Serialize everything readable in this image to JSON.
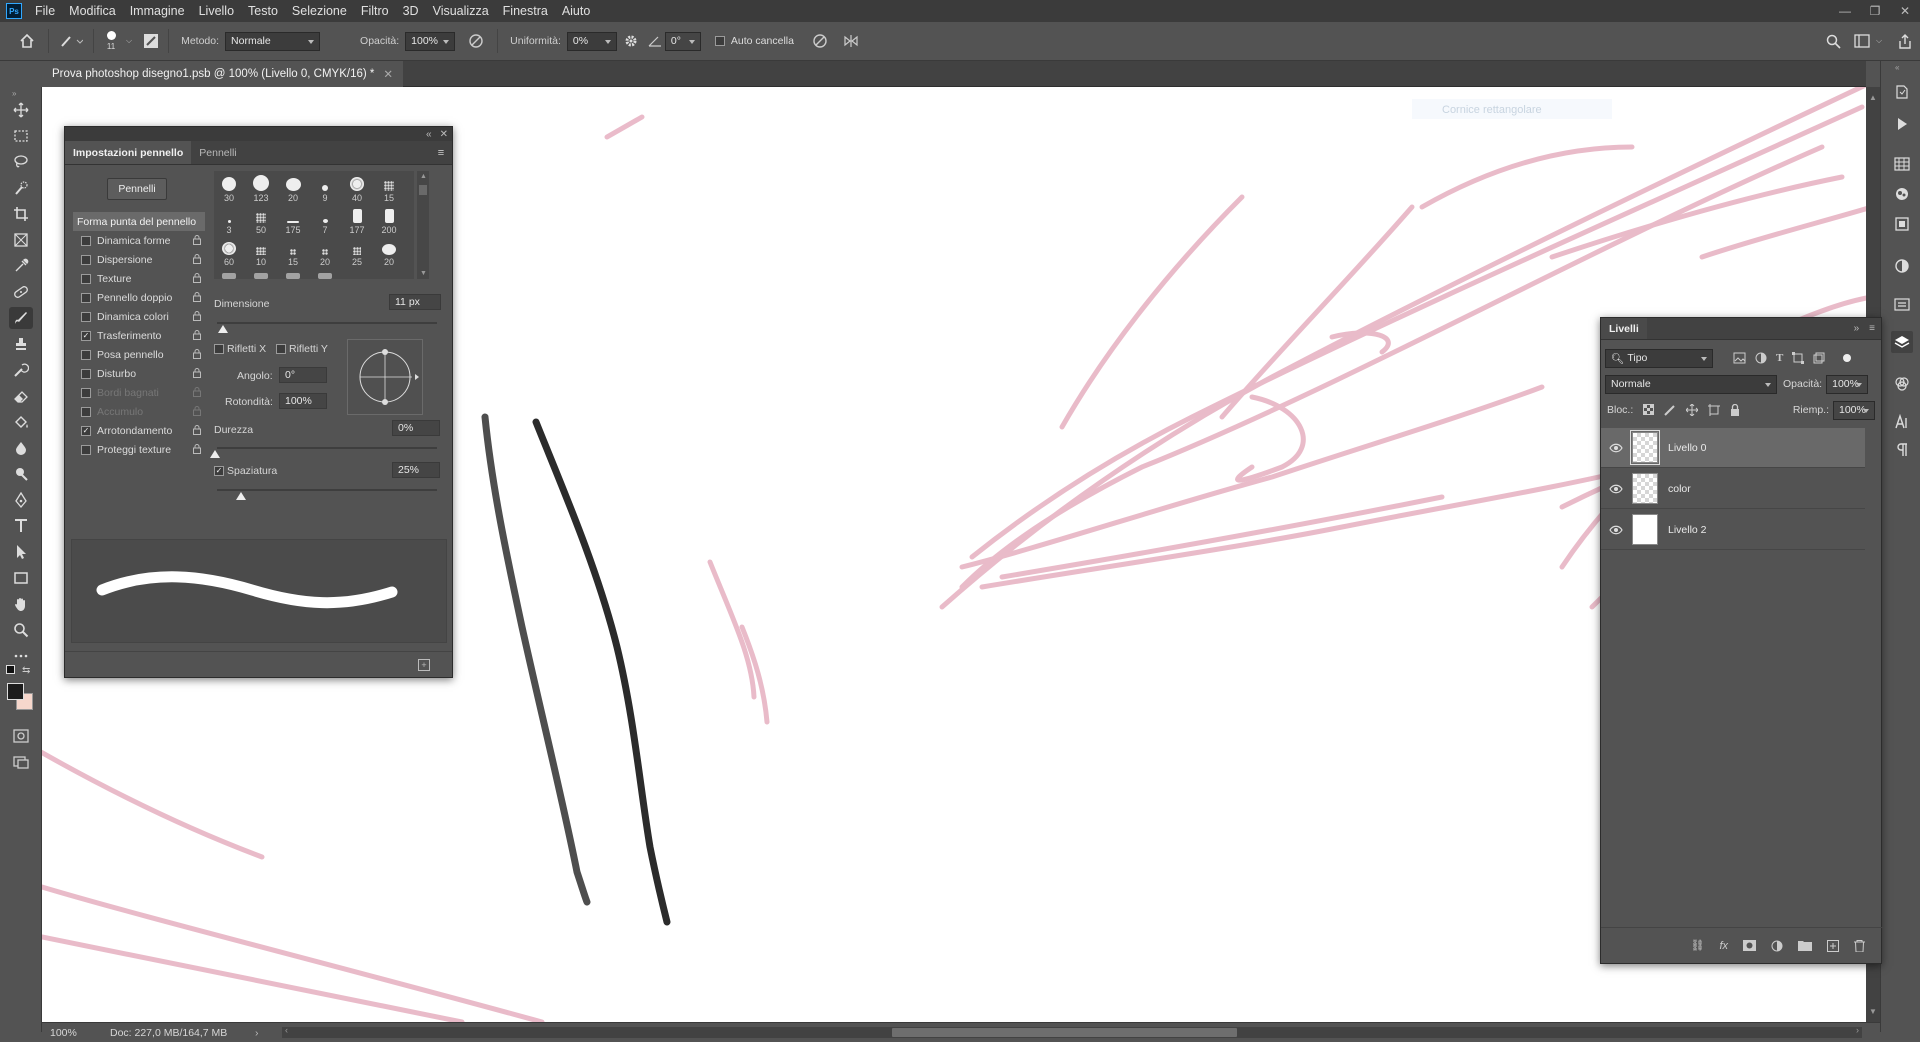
{
  "app": {
    "logo": "Ps"
  },
  "menu": [
    "File",
    "Modifica",
    "Immagine",
    "Livello",
    "Testo",
    "Selezione",
    "Filtro",
    "3D",
    "Visualizza",
    "Finestra",
    "Aiuto"
  ],
  "options": {
    "brush_size": "11",
    "metodo_label": "Metodo:",
    "metodo_value": "Normale",
    "opacita_label": "Opacità:",
    "opacita_value": "100%",
    "uniformita_label": "Uniformità:",
    "uniformita_value": "0%",
    "angle_value": "0°",
    "auto_cancella": "Auto cancella"
  },
  "document": {
    "tab_title": "Prova photoshop disegno1.psb @ 100% (Livello 0, CMYK/16) *",
    "ghost_text": "Cornice rettangolare"
  },
  "status": {
    "zoom": "100%",
    "doc": "Doc: 227,0 MB/164,7 MB"
  },
  "brush_panel": {
    "tabs": [
      "Impostazioni pennello",
      "Pennelli"
    ],
    "button": "Pennelli",
    "options": [
      {
        "label": "Forma punta del pennello",
        "checked": null,
        "head": true
      },
      {
        "label": "Dinamica forme",
        "checked": false
      },
      {
        "label": "Dispersione",
        "checked": false
      },
      {
        "label": "Texture",
        "checked": false
      },
      {
        "label": "Pennello doppio",
        "checked": false
      },
      {
        "label": "Dinamica colori",
        "checked": false
      },
      {
        "label": "Trasferimento",
        "checked": true
      },
      {
        "label": "Posa pennello",
        "checked": false
      },
      {
        "label": "Disturbo",
        "checked": false
      },
      {
        "label": "Bordi bagnati",
        "checked": false,
        "disabled": true
      },
      {
        "label": "Accumulo",
        "checked": false,
        "disabled": true
      },
      {
        "label": "Arrotondamento",
        "checked": true
      },
      {
        "label": "Proteggi texture",
        "checked": false
      }
    ],
    "tip_sizes": [
      "30",
      "123",
      "20",
      "9",
      "40",
      "15",
      "3",
      "50",
      "175",
      "7",
      "177",
      "200",
      "60",
      "10",
      "15",
      "20",
      "25",
      "20"
    ],
    "dimensione_label": "Dimensione",
    "dimensione_value": "11 px",
    "rifletti_x": "Rifletti X",
    "rifletti_y": "Rifletti Y",
    "angolo_label": "Angolo:",
    "angolo_value": "0°",
    "rotondita_label": "Rotondità:",
    "rotondita_value": "100%",
    "durezza_label": "Durezza",
    "durezza_value": "0%",
    "spaziatura_label": "Spaziatura",
    "spaziatura_value": "25%"
  },
  "layers_panel": {
    "title": "Livelli",
    "filter": "Tipo",
    "blend": "Normale",
    "opacita_label": "Opacità:",
    "opacita_value": "100%",
    "blocca_label": "Bloc.:",
    "riemp_label": "Riemp.:",
    "riemp_value": "100%",
    "layers": [
      {
        "name": "Livello 0",
        "selected": true,
        "thumb": "transparent"
      },
      {
        "name": "color",
        "selected": false,
        "thumb": "transparent"
      },
      {
        "name": "Livello 2",
        "selected": false,
        "thumb": "white"
      }
    ]
  },
  "colors": {
    "stroke_pink": "#d8849e",
    "ui_dark": "#3b3b3b",
    "panel": "#535353",
    "ps_blue": "#31a8ff"
  },
  "icons": {
    "toolbar": [
      "move-icon",
      "marquee-icon",
      "lasso-icon",
      "quick-select-icon",
      "crop-icon",
      "frame-icon",
      "eyedropper-icon",
      "healing-icon",
      "brush-icon",
      "stamp-icon",
      "history-brush-icon",
      "eraser-icon",
      "paint-bucket-icon",
      "blur-icon",
      "dodge-icon",
      "pen-icon",
      "type-icon",
      "path-select-icon",
      "rectangle-icon",
      "hand-icon",
      "zoom-icon",
      "more-tools-icon"
    ],
    "right_strip": [
      "history-icon",
      "actions-icon",
      "swatches-icon",
      "color-wheel-icon",
      "libraries-icon",
      "adjustments-icon",
      "properties-icon",
      "layers-icon",
      "channels-icon",
      "character-icon",
      "paragraph-icon"
    ]
  }
}
